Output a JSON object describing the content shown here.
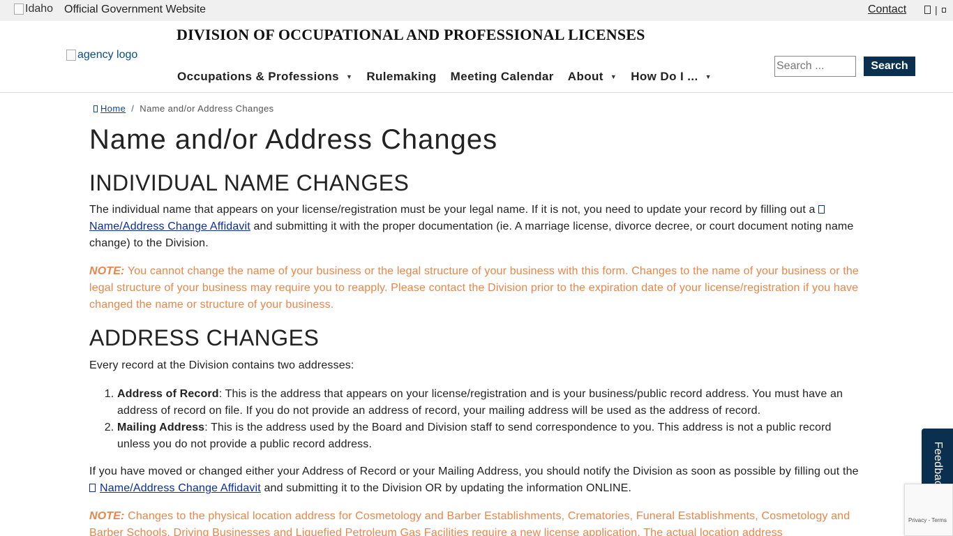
{
  "gov_bar": {
    "flag_alt": "Idaho",
    "official_text": "Official Government Website",
    "contact_label": "Contact",
    "divider": "|"
  },
  "header": {
    "agency_title": "DIVISION OF OCCUPATIONAL AND PROFESSIONAL LICENSES",
    "logo_alt": "agency logo",
    "nav": [
      {
        "label": "Occupations & Professions",
        "has_dropdown": true
      },
      {
        "label": "Rulemaking",
        "has_dropdown": false
      },
      {
        "label": "Meeting Calendar",
        "has_dropdown": false
      },
      {
        "label": "About",
        "has_dropdown": true
      },
      {
        "label": "How Do I ...",
        "has_dropdown": true
      }
    ],
    "search": {
      "placeholder": "Search ...",
      "button_label": "Search"
    }
  },
  "breadcrumb": {
    "home_label": "Home",
    "separator": "/",
    "current": "Name and/or Address Changes"
  },
  "page_title": "Name and/or Address Changes",
  "sections": {
    "individual": {
      "heading": "INDIVIDUAL NAME CHANGES",
      "para_start": "The individual name that appears on your license/registration must be your legal name. If it is not, you need to update your record by filling out a",
      "link_label": "Name/Address Change Affidavit",
      "para_end": "and submitting it with the proper documentation (ie. A marriage license, divorce decree, or court document noting name change) to the Division.",
      "note_label": "NOTE:",
      "note_text": "You cannot change the name of your business or the legal structure of your business with this form. Changes to the name of your business or the legal structure of your business may require you to reapply. Please contact the Division prior to the expiration date of your license/registration if you have changed the name or structure of your business."
    },
    "address": {
      "heading": "ADDRESS CHANGES",
      "intro": "Every record at the Division contains two addresses:",
      "items": [
        {
          "term": "Address of Record",
          "text": ": This is the address that appears on your license/registration and is your business/public record address. You must have an address of record on file. If you do not provide an address of record, your mailing address will be used as the address of record."
        },
        {
          "term": "Mailing Address",
          "text": ": This is the address used by the Board and Division staff to send correspondence to you. This address is not a public record unless you do not provide a public record address."
        }
      ],
      "para_start": "If you have moved or changed either your Address of Record or your Mailing Address, you should notify the Division as soon as possible by filling out the",
      "link_label": "Name/Address Change Affidavit",
      "para_end": "and submitting it to the Division OR by updating the information ONLINE.",
      "note_label": "NOTE:",
      "note_text": "Changes to the physical location address for Cosmetology and Barber Establishments, Crematories, Funeral Establishments, Cosmetology and Barber Schools, Driving Businesses and Liquefied Petroleum Gas Facilities require a new license application. The actual location address"
    }
  },
  "feedback_label": "Feedback",
  "recaptcha_text": "Privacy - Terms",
  "colors": {
    "note": "#e8864a",
    "link": "#0b2e9b",
    "button": "#0a2f4f",
    "gov_bar_bg": "#f0f0f0"
  }
}
